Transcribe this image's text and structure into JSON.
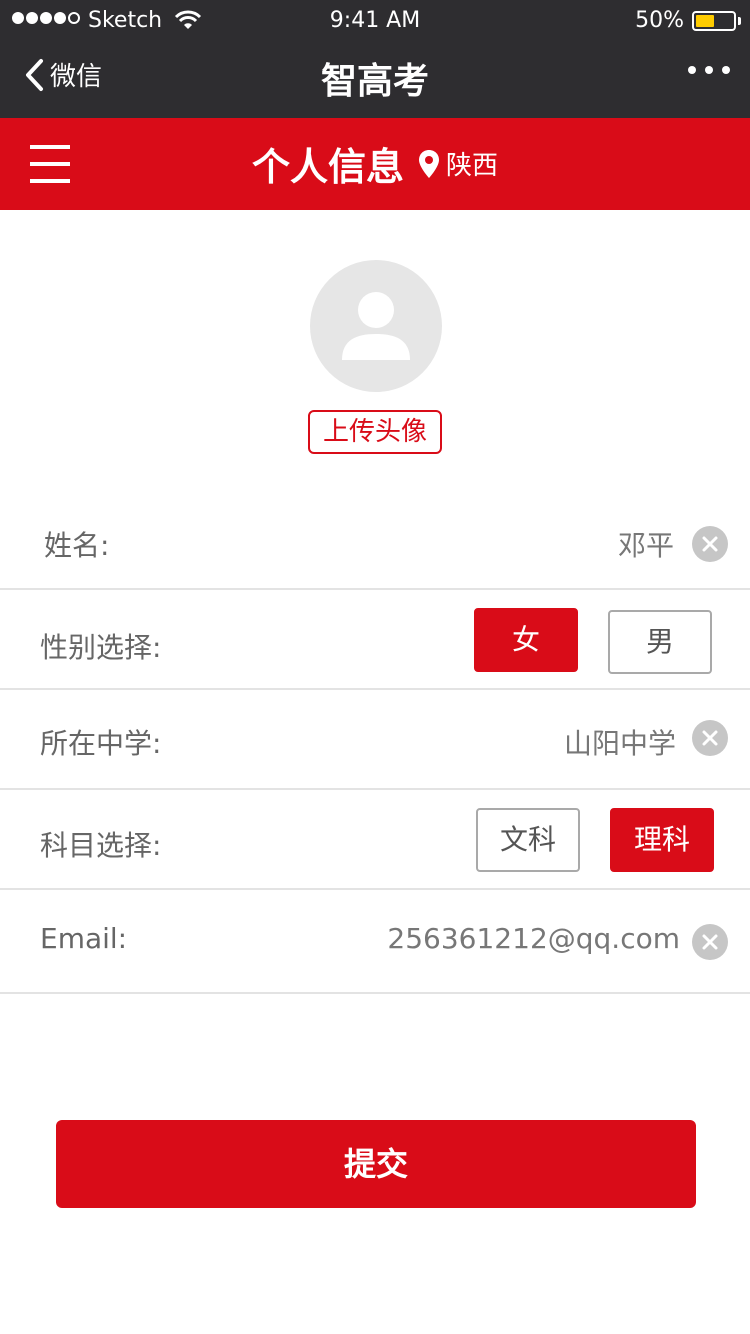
{
  "status_bar": {
    "carrier": "Sketch",
    "time": "9:41 AM",
    "battery": "50%",
    "battery_level": 0.5,
    "signal_icon": "signal-dots-icon",
    "wifi_icon": "wifi-icon",
    "battery_icon": "battery-icon"
  },
  "nav": {
    "back_label": "微信",
    "title": "智高考",
    "back_icon": "chevron-left-icon",
    "more_icon": "more-dots-icon"
  },
  "header": {
    "title": "个人信息",
    "province": "陕西",
    "menu_icon": "hamburger-menu-icon",
    "location_icon": "location-pin-icon",
    "color": "#d90c18"
  },
  "profile": {
    "avatar_icon": "user-avatar-icon",
    "upload_label": "上传头像"
  },
  "form": {
    "name": {
      "label": "姓名:",
      "value": "邓平"
    },
    "gender": {
      "label": "性别选择:",
      "options": [
        "女",
        "男"
      ],
      "selected": "女"
    },
    "school": {
      "label": "所在中学:",
      "value": "山阳中学"
    },
    "subject": {
      "label": "科目选择:",
      "options": [
        "文科",
        "理科"
      ],
      "selected": "理科"
    },
    "email": {
      "label": "Email:",
      "value": "256361212@qq.com"
    },
    "clear_icon": "clear-x-icon"
  },
  "submit_label": "提交"
}
